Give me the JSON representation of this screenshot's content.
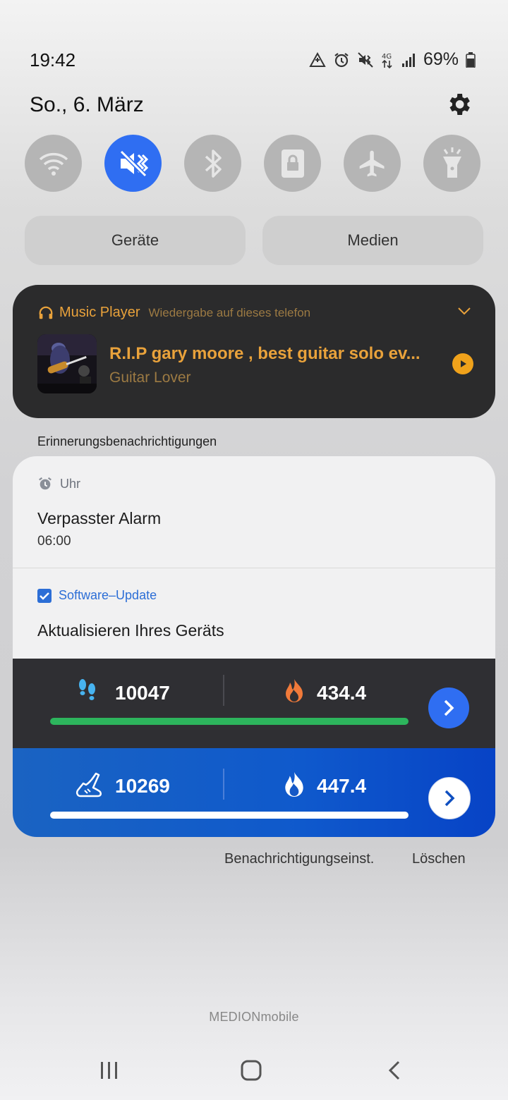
{
  "status_bar": {
    "time": "19:42",
    "battery_percent": "69%",
    "icons": [
      "data-saver-icon",
      "alarm-icon",
      "vibrate-mute-icon",
      "4g-data-icon",
      "signal-icon",
      "battery-icon"
    ]
  },
  "header": {
    "date": "So., 6. März",
    "settings_icon": "gear-icon"
  },
  "quick_settings": {
    "toggles": [
      {
        "name": "wifi",
        "icon": "wifi-icon",
        "on": false
      },
      {
        "name": "mute",
        "icon": "mute-icon",
        "on": true
      },
      {
        "name": "bluetooth",
        "icon": "bluetooth-icon",
        "on": false
      },
      {
        "name": "rotation-lock",
        "icon": "lock-icon",
        "on": false
      },
      {
        "name": "airplane",
        "icon": "airplane-icon",
        "on": false
      },
      {
        "name": "flashlight",
        "icon": "flashlight-icon",
        "on": false
      }
    ],
    "devices_label": "Geräte",
    "media_label": "Medien"
  },
  "music": {
    "app_name": "Music Player",
    "output": "Wiedergabe auf dieses telefon",
    "title": "R.I.P gary moore , best guitar solo ev...",
    "artist": "Guitar Lover",
    "accent": "#E9A23B"
  },
  "notifications": {
    "section_label": "Erinnerungsbenachrichtigungen",
    "clock": {
      "app": "Uhr",
      "title": "Verpasster Alarm",
      "time": "06:00"
    },
    "update": {
      "app": "Software–Update",
      "title": "Aktualisieren Ihres Geräts"
    },
    "health_dark": {
      "steps": "10047",
      "calories": "434.4",
      "progress": 1.0,
      "bar_color": "#2DB55D"
    },
    "health_blue": {
      "steps": "10269",
      "calories": "447.4",
      "progress": 1.0
    }
  },
  "actions": {
    "settings": "Benachrichtigungseinst.",
    "clear": "Löschen"
  },
  "carrier": "MEDIONmobile",
  "nav": [
    "recents-icon",
    "home-icon",
    "back-icon"
  ]
}
